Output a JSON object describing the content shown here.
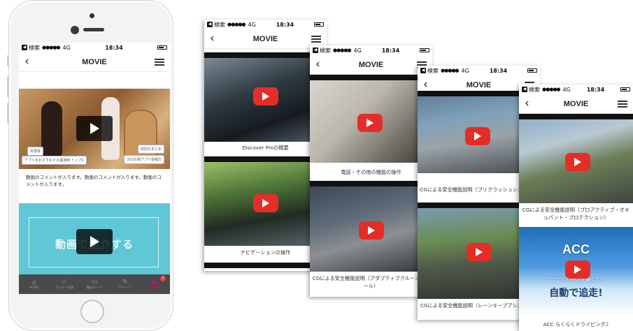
{
  "status": {
    "carrier": "検索",
    "signal": "●●●●●",
    "network": "4G",
    "time": "18:34"
  },
  "nav": {
    "back_icon": "‹",
    "title": "MOVIE"
  },
  "main": {
    "hero_tags": [
      "本部長",
      "アプリをおすすめする講演時 トップ2",
      "前回のまとめ",
      "次のお題アプリ投稿方"
    ],
    "comment": "動画のコメントが入ります。動画のコメントが入ります。動画のコメントが入ります。",
    "banner_text": "動画で紹介する",
    "tabs": [
      {
        "icon": "home-icon",
        "glyph": "⌂",
        "label": "HOME"
      },
      {
        "icon": "star-icon",
        "glyph": "☆",
        "label": "ブックー記録"
      },
      {
        "icon": "screen-icon",
        "glyph": "▭",
        "label": "動画ページ"
      },
      {
        "icon": "clip-icon",
        "glyph": "✎",
        "label": "クリップ"
      },
      {
        "icon": "movie-icon",
        "glyph": "▶",
        "label": "MOVIE",
        "badge": "7"
      }
    ]
  },
  "cards": [
    {
      "captions": [
        "Discover Proの概要",
        "ナビゲーションの操作"
      ]
    },
    {
      "captions": [
        "電話・その他の機能の操作",
        "CGによる安全機能説明（アダプティブクルーントロール）"
      ]
    },
    {
      "captions": [
        "CGによる安全機能説明（プリクラッシュシステム）",
        "CGによる安全機能説明（レーンキープアシステム）"
      ]
    },
    {
      "captions": [
        "CGによる安全機能説明（プロアクティブ・オキュパント・プロテクション）",
        "ACC らくらくドライビング♪"
      ]
    }
  ],
  "overlays": {
    "acc_title": "ACC",
    "acc_sub": "アクセルから足を離しても",
    "acc_main": "自動で追走!",
    "youtube": "YouTube"
  }
}
